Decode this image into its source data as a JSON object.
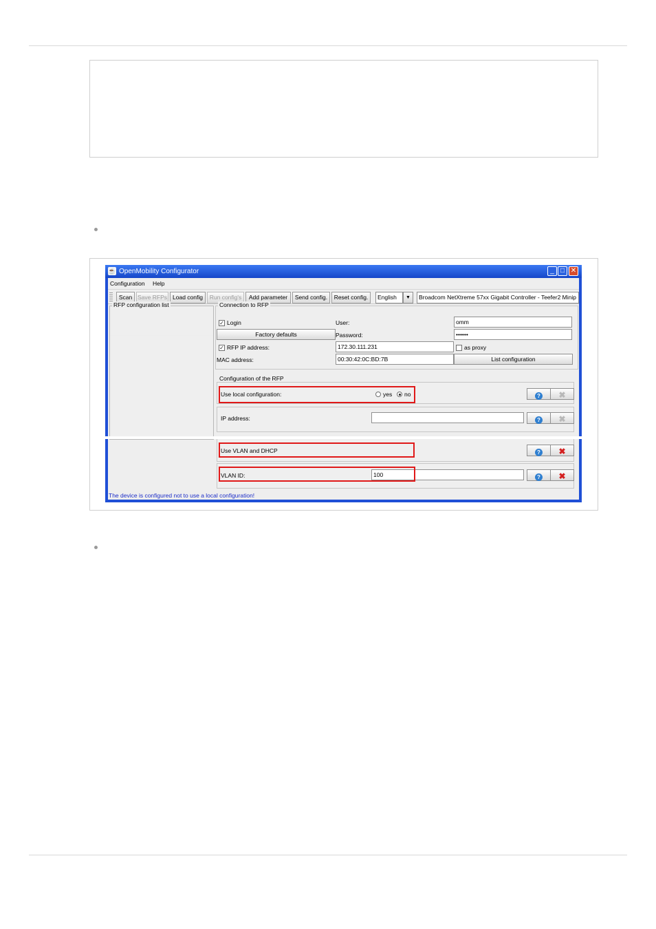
{
  "window": {
    "title": "OpenMobility Configurator",
    "buttons": {
      "minimize": "_",
      "maximize": "□",
      "close": "✕"
    }
  },
  "menu": [
    "Configuration",
    "Help"
  ],
  "toolbar": {
    "scan": "Scan",
    "save_rfps": "Save RFPs",
    "load_config": "Load config",
    "run_configs": "Run config's",
    "add_parameter": "Add parameter",
    "send_config": "Send config.",
    "reset_config": "Reset config.",
    "language": "English",
    "adapter": "Broadcom NetXtreme 57xx Gigabit Controller - Teefer2 Minip"
  },
  "rfp_list": {
    "label": "RFP configuration list"
  },
  "connection": {
    "label": "Connection to RFP",
    "login_label": "Login",
    "login_checked": true,
    "user_label": "User:",
    "user_value": "omm",
    "factory_defaults": "Factory defaults",
    "password_label": "Password:",
    "password_value": "••••••",
    "rfp_ip_label": "RFP IP address:",
    "rfp_ip_checked": true,
    "rfp_ip_value": "172.30.111.231",
    "as_proxy_label": "as proxy",
    "as_proxy_checked": false,
    "mac_label": "MAC address:",
    "mac_value": "00:30:42:0C:BD:7B",
    "list_configuration": "List configuration"
  },
  "config": {
    "label": "Configuration of the RFP",
    "use_local_label": "Use local configuration:",
    "yes_label": "yes",
    "no_label": "no",
    "selected": "no",
    "ip_label": "IP address:",
    "ip_value": "",
    "vlan_dhcp_label": "Use VLAN and DHCP",
    "vlan_id_label": "VLAN ID:",
    "vlan_id_value": "100",
    "help_icon": "?",
    "delete_icon": "✖"
  },
  "status_text": "The device is configured not to use a local configuration!",
  "colors": {
    "highlight": "#e01818",
    "status": "#1c2dc8",
    "title_bar": "#1f4fd6"
  }
}
